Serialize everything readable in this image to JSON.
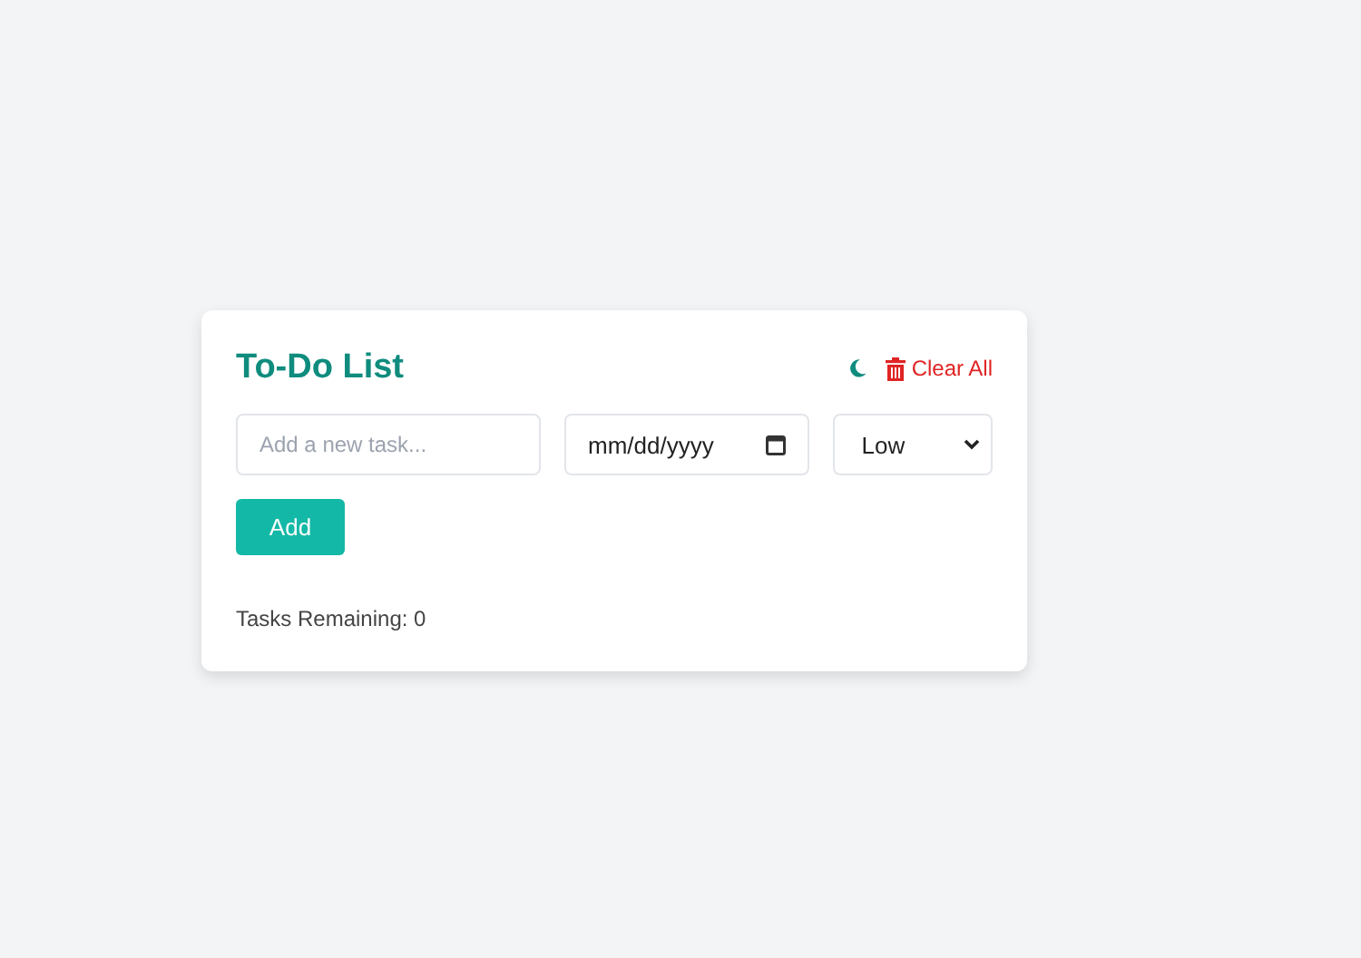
{
  "title": "To-Do List",
  "theme_toggle": {
    "dark": false
  },
  "clear_button": {
    "label": "Clear All"
  },
  "task_field": {
    "placeholder": "Add a new task..."
  },
  "date_field": {
    "placeholder": "mm/dd/yyyy"
  },
  "priority_select": {
    "value": "Low"
  },
  "add_button": {
    "label": "Add"
  },
  "status": "Tasks Remaining: 0"
}
